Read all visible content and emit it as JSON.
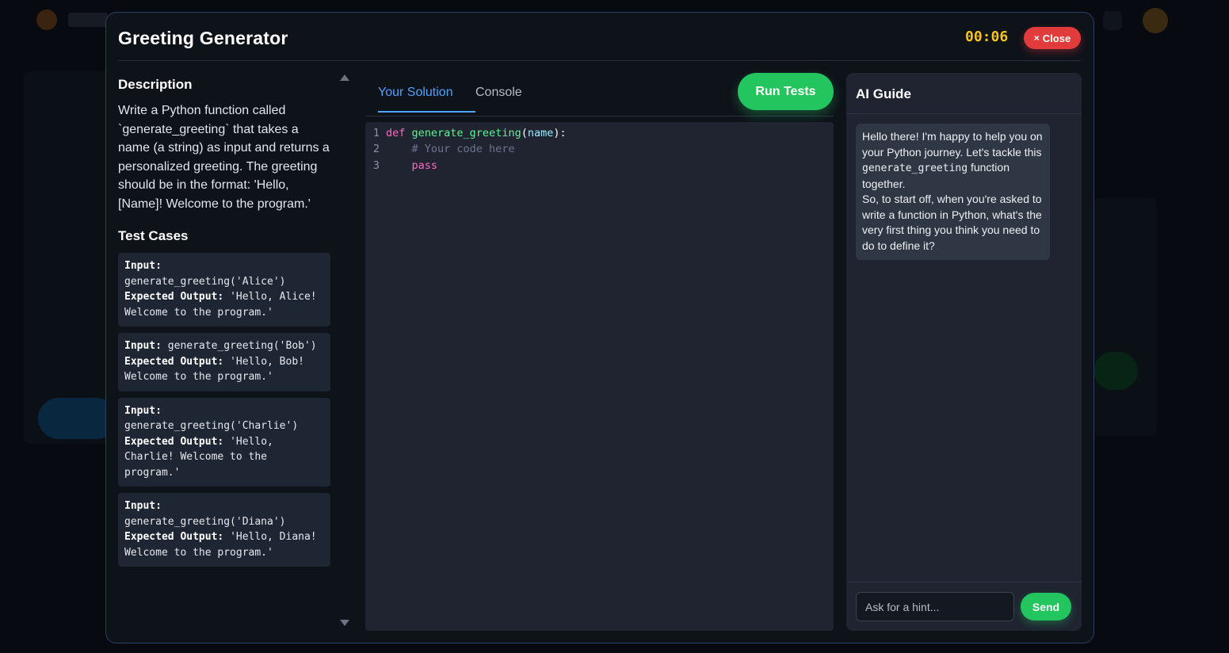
{
  "modal": {
    "title": "Greeting Generator",
    "timer": "00:06",
    "close_icon": "×",
    "close_label": "Close"
  },
  "description": {
    "title": "Description",
    "text": "Write a Python function called `generate_greeting` that takes a name (a string) as input and returns a personalized greeting. The greeting should be in the format: 'Hello, [Name]! Welcome to the program.'"
  },
  "test_cases": {
    "title": "Test Cases",
    "input_label": "Input:",
    "expected_label": "Expected Output:",
    "items": [
      {
        "input": "generate_greeting('Alice')",
        "expected": "'Hello, Alice! Welcome to the program.'"
      },
      {
        "input": "generate_greeting('Bob')",
        "expected": "'Hello, Bob! Welcome to the program.'"
      },
      {
        "input": "generate_greeting('Charlie')",
        "expected": "'Hello, Charlie! Welcome to the program.'"
      },
      {
        "input": "generate_greeting('Diana')",
        "expected": "'Hello, Diana! Welcome to the program.'"
      }
    ]
  },
  "editor": {
    "tabs": [
      "Your Solution",
      "Console"
    ],
    "active_tab": "Your Solution",
    "run_label": "Run Tests",
    "lines": [
      {
        "num": "1",
        "text": "def generate_greeting(name):"
      },
      {
        "num": "2",
        "text": "    # Your code here"
      },
      {
        "num": "3",
        "text": "    pass"
      }
    ]
  },
  "ai_guide": {
    "title": "AI Guide",
    "message_part1": "Hello there! I'm happy to help you on your Python journey. Let's tackle this ",
    "message_code": "generate_greeting",
    "message_part2": " function together.",
    "message_part3": "So, to start off, when you're asked to write a function in Python, what's the very first thing you think you need to do to define it?",
    "input_placeholder": "Ask for a hint...",
    "input_value": "",
    "send_label": "Send"
  },
  "colors": {
    "accent_blue": "#4da3ff",
    "run_green": "#22c55e",
    "close_red": "#e23b3b",
    "timer_yellow": "#f5c518"
  }
}
